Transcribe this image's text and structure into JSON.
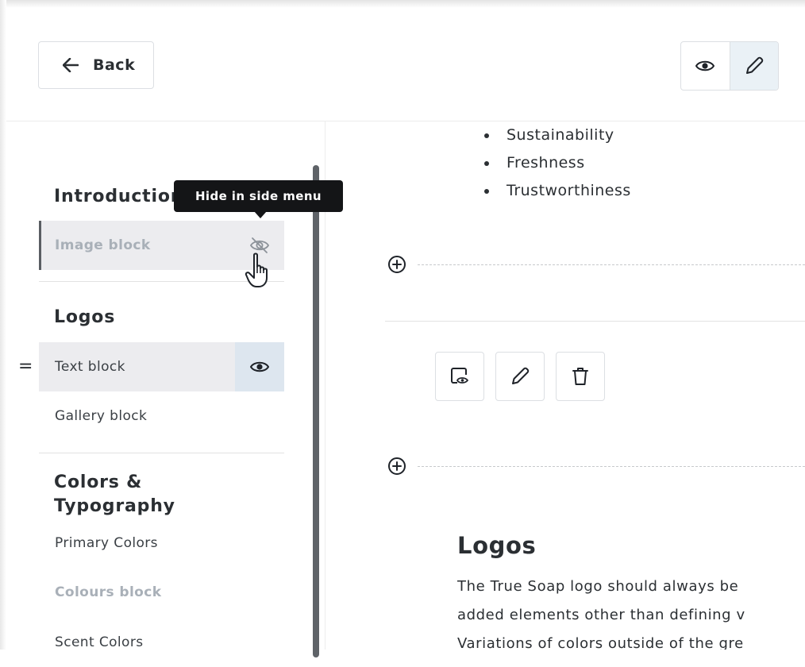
{
  "header": {
    "back_label": "Back",
    "mode_icons": [
      "eye-icon",
      "pencil-icon"
    ],
    "active_mode": "edit"
  },
  "sidebar": {
    "sections": [
      {
        "title": "Introduction",
        "items": [
          {
            "label": "Image block",
            "hidden": true,
            "action_icon": "eye-off-icon"
          }
        ]
      },
      {
        "title": "Logos",
        "items": [
          {
            "label": "Text block",
            "hidden": false,
            "hovered": true,
            "action_icon": "eye-icon"
          },
          {
            "label": "Gallery block",
            "hidden": false
          }
        ]
      },
      {
        "title": "Colors & Typography",
        "items": [
          {
            "label": "Primary Colors",
            "hidden": false
          },
          {
            "label": "Colours block",
            "hidden": true
          },
          {
            "label": "Scent Colors",
            "hidden": false
          }
        ]
      }
    ],
    "drag_handle": "=",
    "tooltip": "Hide in side menu"
  },
  "main": {
    "bullets": [
      "Sustainability",
      "Freshness",
      "Trustworthiness"
    ],
    "toolbar_icons": [
      "hide-block-icon",
      "pencil-icon",
      "trash-icon"
    ],
    "logos_heading": "Logos",
    "logos_paragraph": [
      "The True Soap logo should always be",
      "added elements other than defining v",
      "Variations of colors outside of the gre"
    ]
  },
  "colors": {
    "accent_active": "#dde6ef",
    "tooltip_bg": "#141517",
    "muted_text": "#a9b0b8"
  }
}
